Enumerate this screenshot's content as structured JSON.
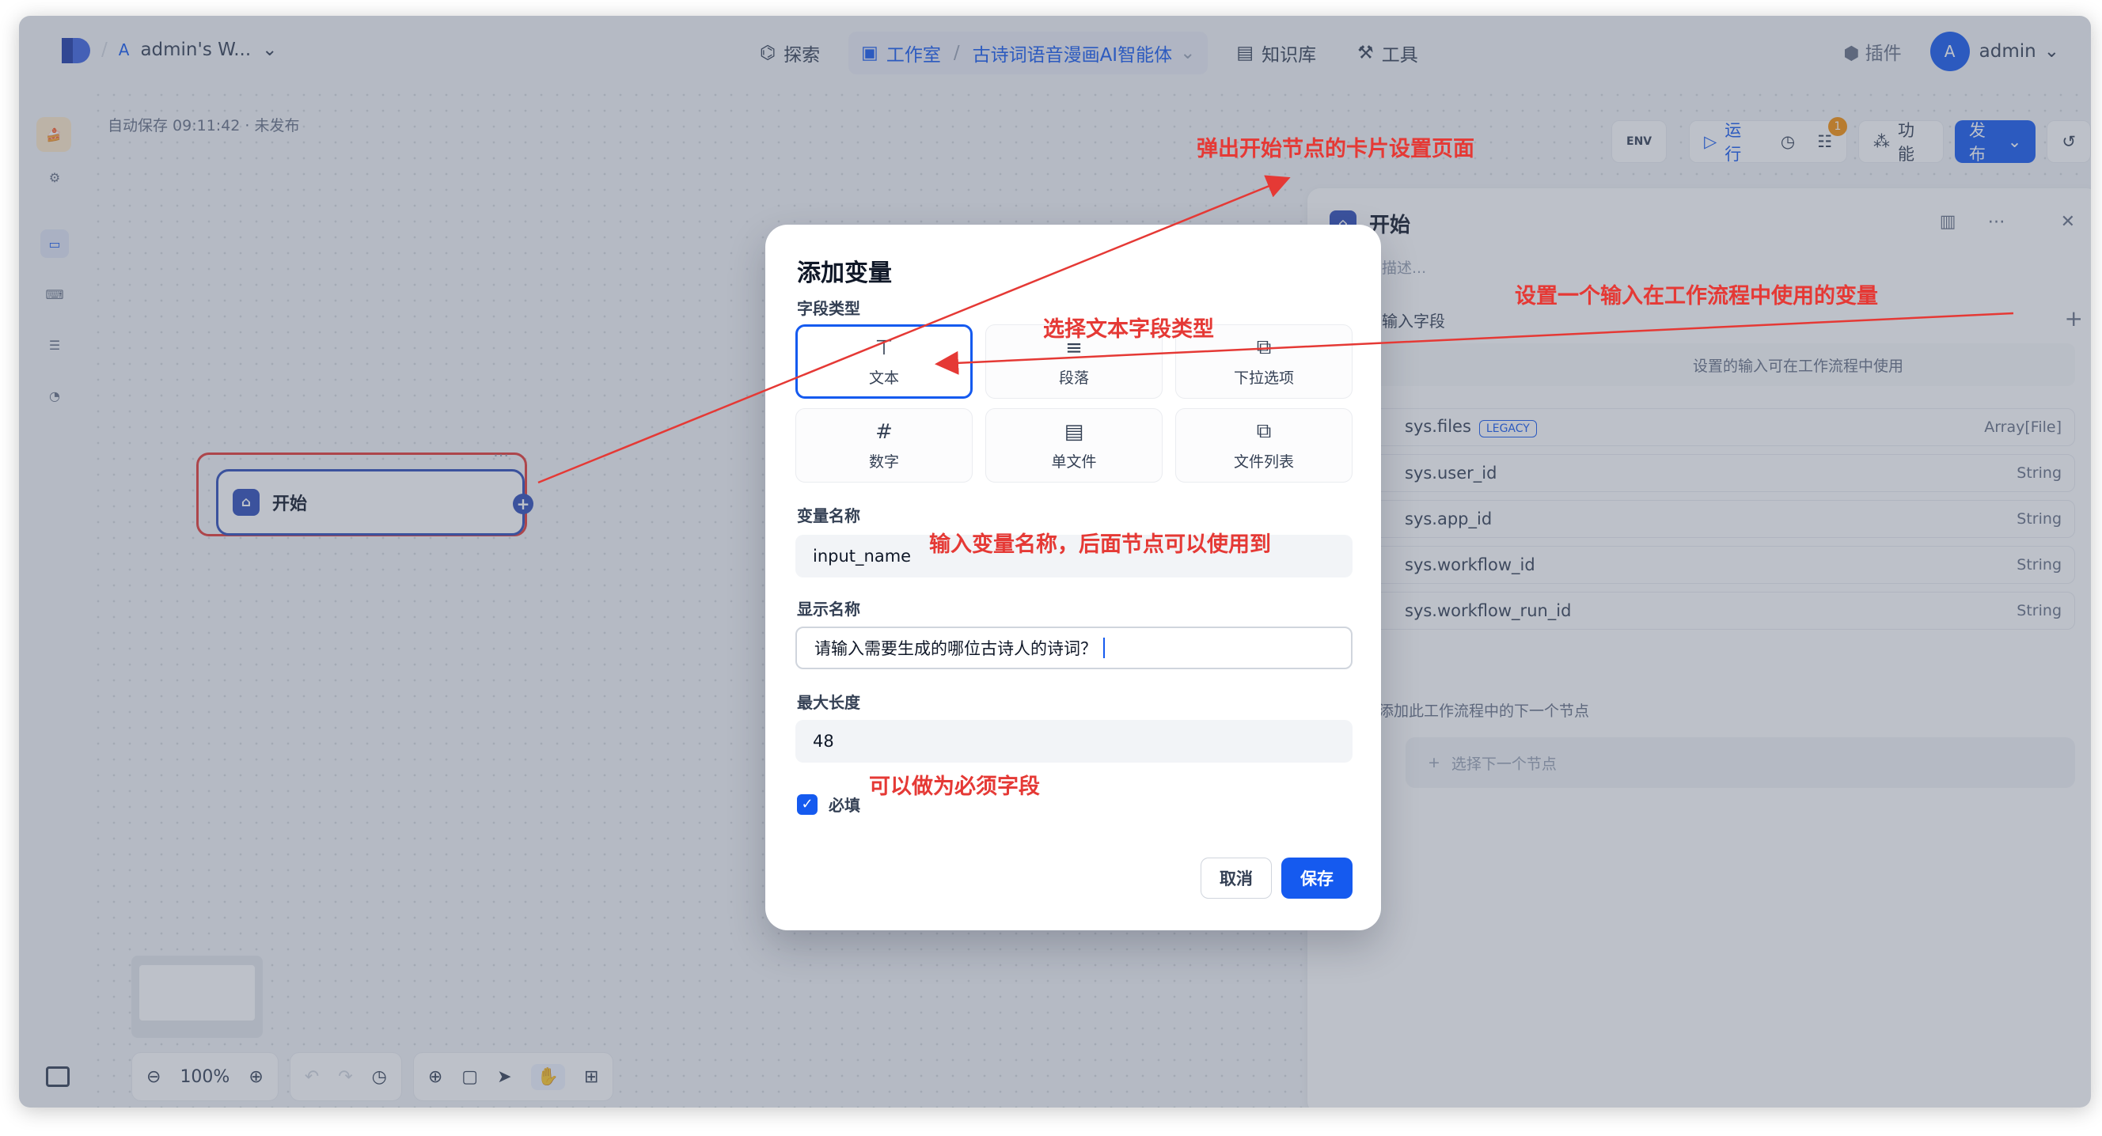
{
  "header": {
    "workspace_initial": "A",
    "workspace_name": "admin's W...",
    "nav_explore": "探索",
    "nav_studio": "工作室",
    "nav_app": "古诗词语音漫画AI智能体",
    "nav_knowledge": "知识库",
    "nav_tools": "工具",
    "plugins": "插件",
    "user_initial": "A",
    "user_name": "admin"
  },
  "canvas": {
    "autosave": "自动保存 09:11:42 · 未发布",
    "start_node_label": "开始",
    "zoom": "100%"
  },
  "toolbar": {
    "env_label": "ENV",
    "run": "运行",
    "badge": "1",
    "features": "功能",
    "publish": "发布"
  },
  "panel": {
    "title": "开始",
    "description": "描述...",
    "field_label": "输入字段",
    "hint": "设置的输入可在工作流程中使用",
    "vars": [
      {
        "name": "sys.files",
        "badge": "LEGACY",
        "type": "Array[File]"
      },
      {
        "name": "sys.user_id",
        "type": "String"
      },
      {
        "name": "sys.app_id",
        "type": "String"
      },
      {
        "name": "sys.workflow_id",
        "type": "String"
      },
      {
        "name": "sys.workflow_run_id",
        "type": "String"
      }
    ],
    "next_label": "添加此工作流程中的下一个节点",
    "next_placeholder": "选择下一个节点"
  },
  "modal": {
    "title": "添加变量",
    "field_type_label": "字段类型",
    "types": [
      "文本",
      "段落",
      "下拉选项",
      "数字",
      "单文件",
      "文件列表"
    ],
    "var_name_label": "变量名称",
    "var_name_value": "input_name",
    "display_name_label": "显示名称",
    "display_name_value": "请输入需要生成的哪位古诗人的诗词？",
    "max_length_label": "最大长度",
    "max_length_value": "48",
    "required_label": "必填",
    "cancel": "取消",
    "save": "保存"
  },
  "annotations": {
    "a1": "弹出开始节点的卡片设置页面",
    "a2": "设置一个输入在工作流程中使用的变量",
    "a3": "选择文本字段类型",
    "a4": "输入变量名称，后面节点可以使用到",
    "a5": "可以做为必须字段"
  },
  "colors": {
    "primary": "#155aef",
    "annotation_red": "#e53935",
    "node_border": "#2e4db8"
  }
}
